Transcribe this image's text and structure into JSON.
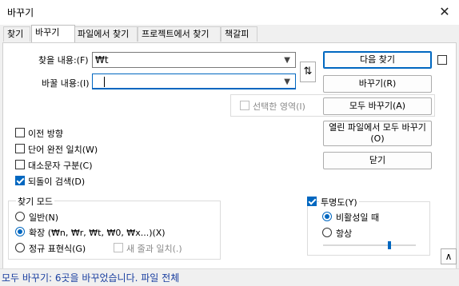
{
  "window": {
    "title": "바꾸기",
    "close_glyph": "✕"
  },
  "tabs": [
    "찾기",
    "바꾸기",
    "파일에서 찾기",
    "프로젝트에서 찾기",
    "책갈피"
  ],
  "find": {
    "label": "찾을 내용:(F)",
    "value": "₩t"
  },
  "replace": {
    "label": "바꿀 내용:(I)",
    "value": ""
  },
  "swap_glyph": "⇅",
  "in_selection": {
    "label": "선택한 영역(I)",
    "checked": false,
    "enabled": false
  },
  "buttons": {
    "find_next": "다음 찾기",
    "replace": "바꾸기(R)",
    "replace_all": "모두 바꾸기(A)",
    "replace_all_open_line1": "열린 파일에서 모두 바꾸기",
    "replace_all_open_line2": "(O)",
    "close": "닫기"
  },
  "options": [
    {
      "label": "이전 방향",
      "checked": false
    },
    {
      "label": "단어 완전 일치(W)",
      "checked": false
    },
    {
      "label": "대소문자 구분(C)",
      "checked": false
    },
    {
      "label": "되돌이 검색(D)",
      "checked": true
    }
  ],
  "search_mode": {
    "title": "찾기 모드",
    "normal": "일반(N)",
    "extended": "확장 (₩n, ₩r, ₩t, ₩0, ₩x...)(X)",
    "regex": "정규 표현식(G)",
    "dot_newline": "새 줄과 일치(.)",
    "selected": "extended"
  },
  "transparency": {
    "label": "투명도(Y)",
    "checked": true,
    "on_lose_focus": "비활성일 때",
    "always": "항상",
    "selected": "on_lose_focus",
    "level": 0.8
  },
  "status": "모두 바꾸기: 6곳을 바꾸었습니다. 파일 전체",
  "colors": {
    "accent": "#0067c0",
    "status_text": "#1a3fa0"
  }
}
